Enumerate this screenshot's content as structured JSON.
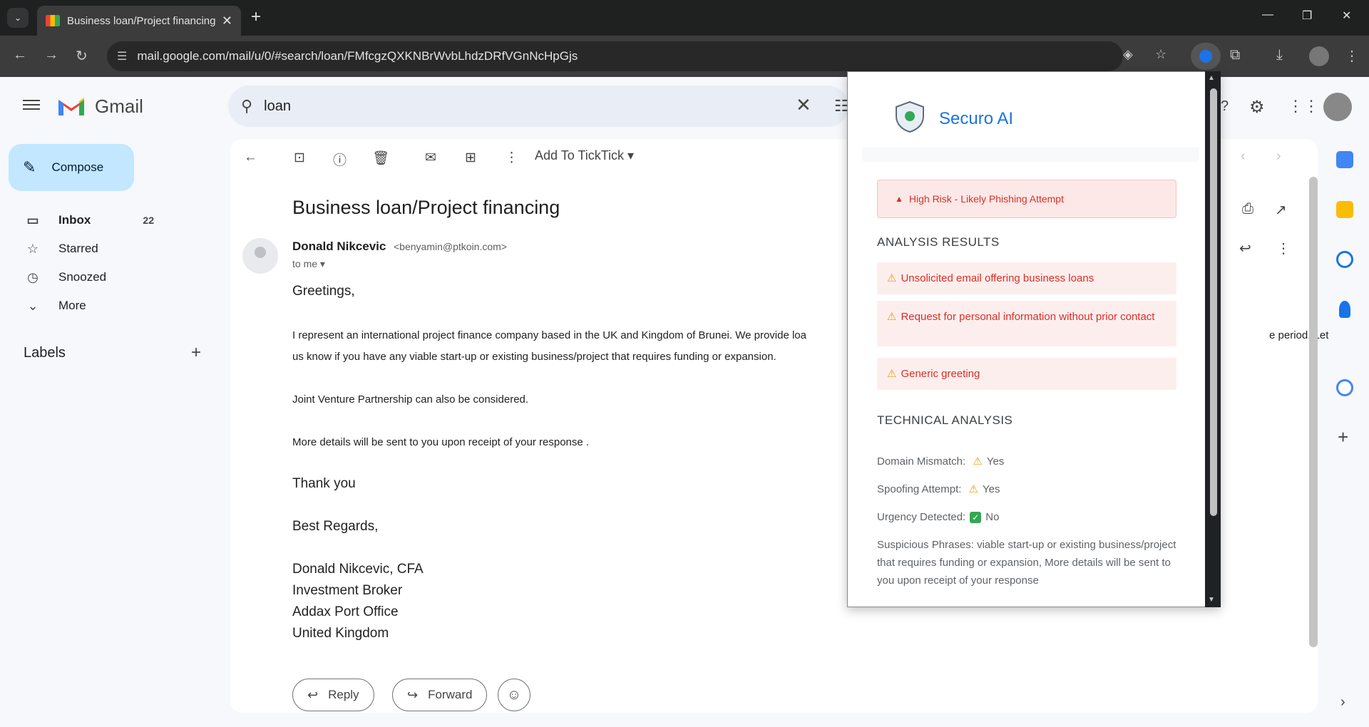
{
  "browser": {
    "tab_title": "Business loan/Project financing",
    "url": "mail.google.com/mail/u/0/#search/loan/FMfcgzQXKNBrWvbLhdzDRfVGnNcHpGjs"
  },
  "gmail": {
    "app_name": "Gmail",
    "search_value": "loan",
    "compose_label": "Compose",
    "sidebar": [
      {
        "label": "Inbox",
        "count": "22",
        "icon": "inbox-icon"
      },
      {
        "label": "Starred",
        "count": "",
        "icon": "star-icon"
      },
      {
        "label": "Snoozed",
        "count": "",
        "icon": "clock-icon"
      },
      {
        "label": "More",
        "count": "",
        "icon": "chevron-down-icon"
      }
    ],
    "labels_heading": "Labels",
    "toolbar": {
      "ticktick_label": "Add To TickTick"
    },
    "email": {
      "subject": "Business loan/Project financing",
      "sender_name": "Donald Nikcevic",
      "sender_email": "<benyamin@ptkoin.com>",
      "to_me": "to me",
      "greeting": "Greetings,",
      "para1_line1": "I represent an international project finance company based in the UK and Kingdom of Brunei. We provide loa",
      "para1_line2": "us know if you have any viable start-up or existing business/project that requires funding or expansion.",
      "para1_right": "e period. Let",
      "para2": "Joint Venture Partnership can also be considered.",
      "para3": "More details will be sent to you upon receipt of your response .",
      "thanks": "Thank you",
      "regards": "Best Regards,",
      "sig1": "Donald Nikcevic, CFA",
      "sig2": "Investment Broker",
      "sig3": "Addax Port Office",
      "sig4": "United Kingdom"
    },
    "reply_label": "Reply",
    "forward_label": "Forward"
  },
  "securo": {
    "title": "Securo AI",
    "risk_label": "High Risk - Likely Phishing Attempt",
    "analysis_heading": "ANALYSIS RESULTS",
    "findings": [
      "Unsolicited email offering business loans",
      "Request for personal information without prior contact",
      "Generic greeting"
    ],
    "technical_heading": "TECHNICAL ANALYSIS",
    "domain_mismatch_label": "Domain Mismatch:",
    "domain_mismatch_value": "Yes",
    "spoofing_label": "Spoofing Attempt:",
    "spoofing_value": "Yes",
    "urgency_label": "Urgency Detected:",
    "urgency_value": "No",
    "phrases_label": "Suspicious Phrases:",
    "phrases_value": "viable start-up or existing business/project that requires funding or expansion, More details will be sent to you upon receipt of your response"
  },
  "colors": {
    "accent": "#1a73e8",
    "risk": "#d93025",
    "warning": "#f29900",
    "ok": "#34a853"
  }
}
